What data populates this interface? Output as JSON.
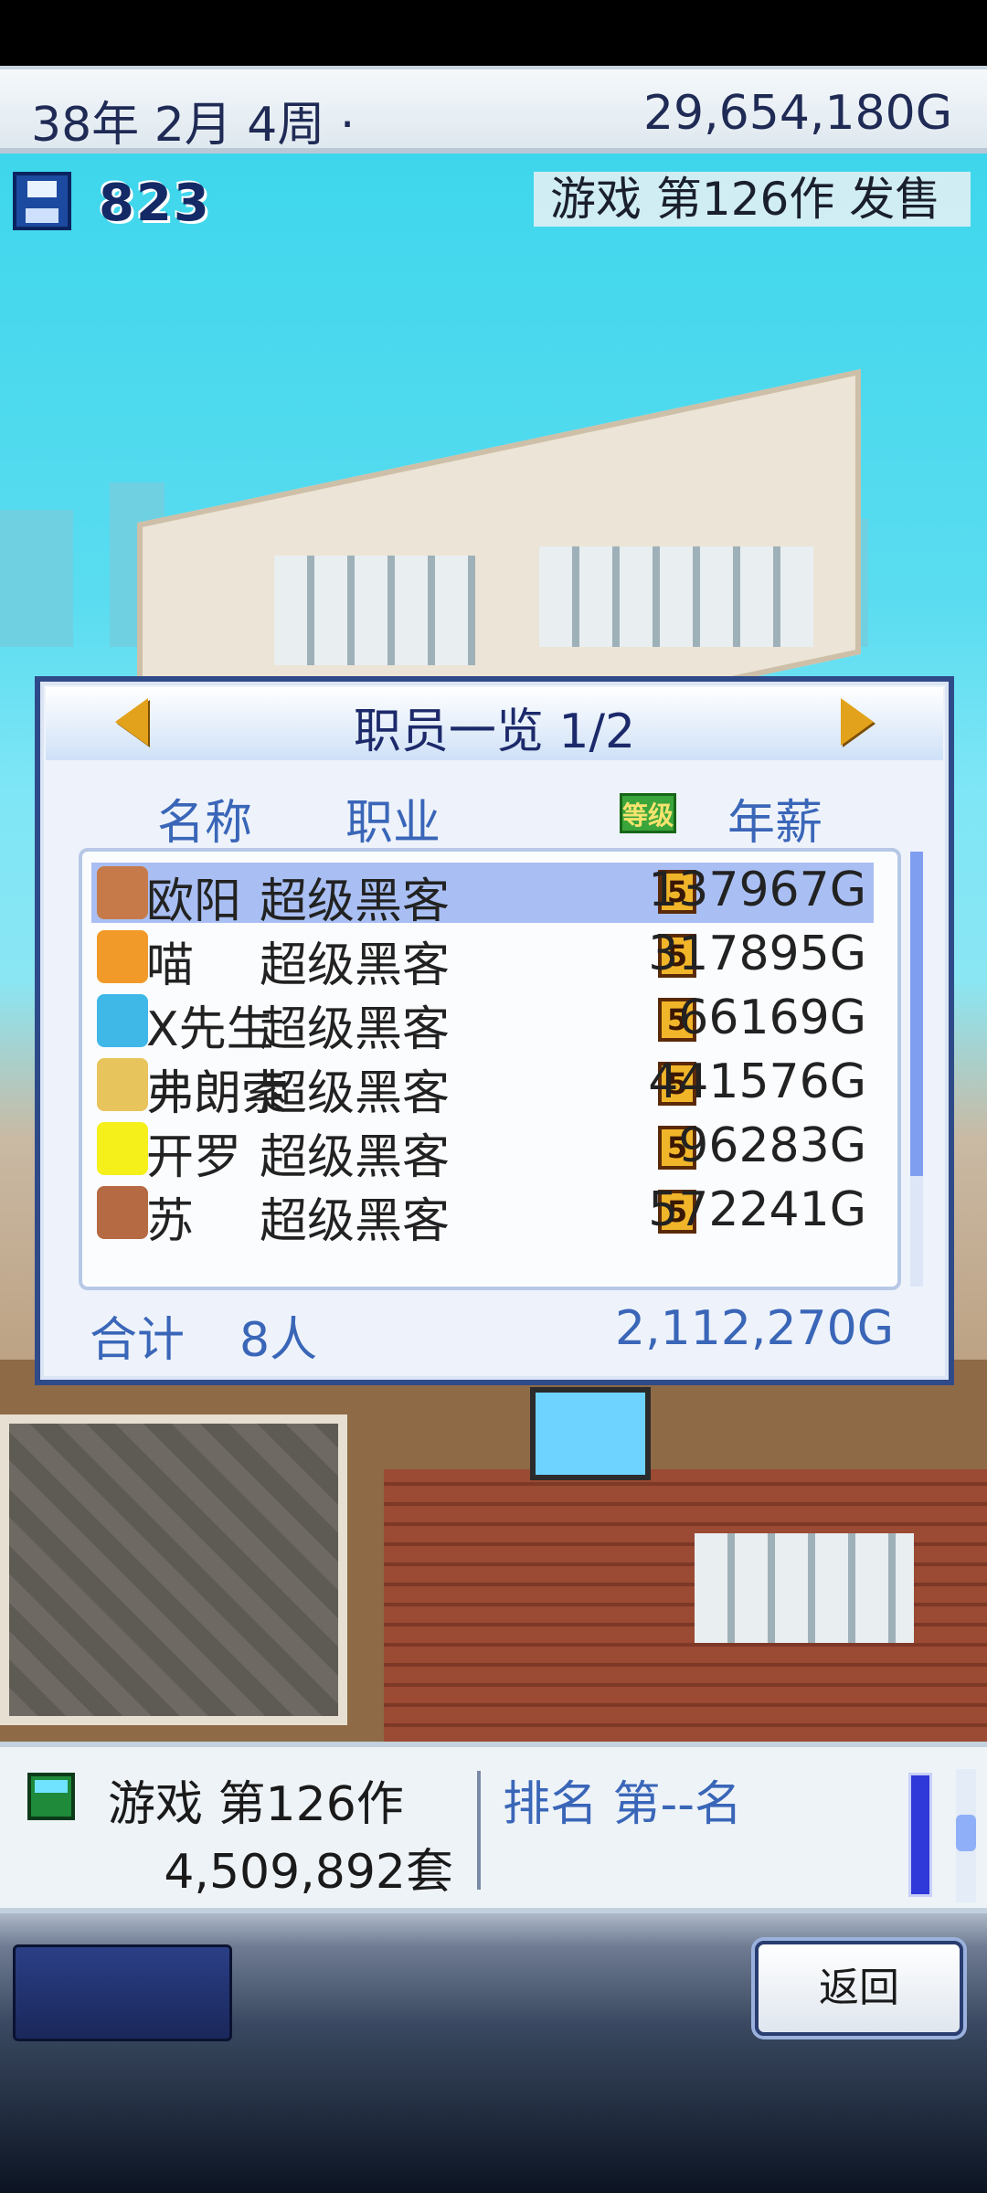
{
  "top_bar": {
    "date": "38年 2月 4周 ·",
    "money": "29,654,180G"
  },
  "hud": {
    "points": "823",
    "release_notice": "游戏 第126作 发售"
  },
  "staff_panel": {
    "title": "职员一览 1/2",
    "columns": {
      "name": "名称",
      "job": "职业",
      "level_badge": "等级",
      "salary": "年薪"
    },
    "rows": [
      {
        "name": "欧阳",
        "job": "超级黑客",
        "level": "5",
        "salary": "137967G",
        "avatar_color": "#c67a4a",
        "selected": true
      },
      {
        "name": "喵",
        "job": "超级黑客",
        "level": "5",
        "salary": "317895G",
        "avatar_color": "#f19a2a",
        "selected": false
      },
      {
        "name": "X先生",
        "job": "超级黑客",
        "level": "5",
        "salary": "66169G",
        "avatar_color": "#3fb8e8",
        "selected": false
      },
      {
        "name": "弗朗索",
        "job": "超级黑客",
        "level": "5",
        "salary": "441576G",
        "avatar_color": "#e7c45c",
        "selected": false
      },
      {
        "name": "开罗",
        "job": "超级黑客",
        "level": "5",
        "salary": "96283G",
        "avatar_color": "#f6f01a",
        "selected": false
      },
      {
        "name": "苏",
        "job": "超级黑客",
        "level": "5",
        "salary": "572241G",
        "avatar_color": "#b56a43",
        "selected": false
      }
    ],
    "footer": {
      "total_label": "合计",
      "count": "8人",
      "sum": "2,112,270G"
    }
  },
  "bottom_info": {
    "game_title": "游戏 第126作",
    "sales": "4,509,892套",
    "rank": "排名 第--名"
  },
  "buttons": {
    "back": "返回"
  }
}
